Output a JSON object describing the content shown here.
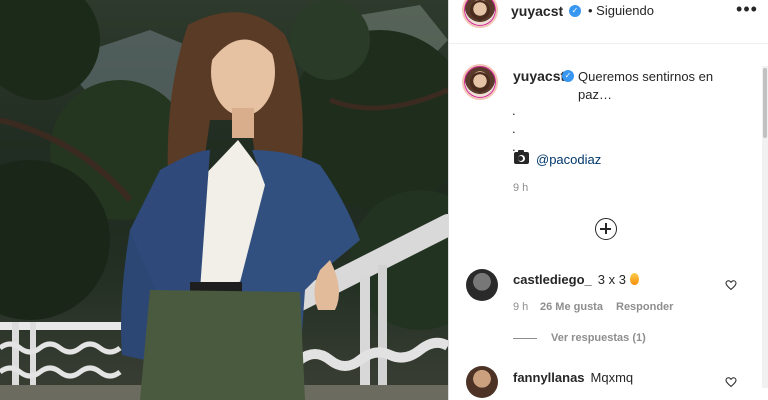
{
  "post": {
    "username": "yuyacst",
    "follow_status": "• Siguiendo",
    "more_label": "•••"
  },
  "caption": {
    "username": "yuyacst",
    "text": "Queremos sentirnos en paz…",
    "dot_lines": [
      ".",
      ".",
      "."
    ],
    "mention": "@pacodiaz",
    "time": "9 h"
  },
  "comments": [
    {
      "username": "castlediego_",
      "text": "3 x 3",
      "time": "9 h",
      "likes": "26 Me gusta",
      "reply_label": "Responder",
      "view_replies": "Ver respuestas (1)"
    },
    {
      "username": "fannyllanas",
      "text": "Mqxmq"
    }
  ],
  "colors": {
    "accent": "#3897f0",
    "mention": "#00376b",
    "muted": "#8e8e8e"
  },
  "icons": {
    "more": "more-horizontal-icon",
    "verified": "verified-badge-icon",
    "camera": "camera-icon",
    "add": "plus-circle-icon",
    "like": "heart-icon",
    "flame": "fire-emoji-icon"
  }
}
